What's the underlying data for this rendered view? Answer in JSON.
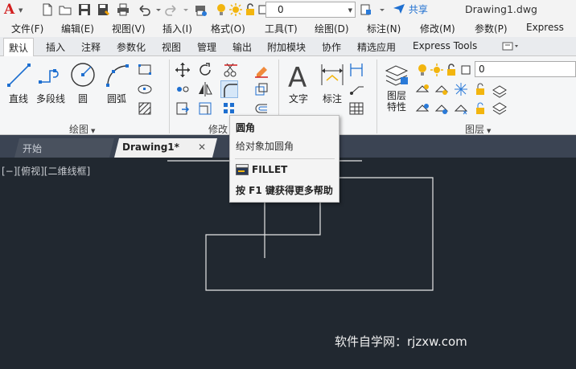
{
  "title_bar": {
    "app_logo": "A",
    "layer_value": "0",
    "share_label": "共享",
    "document_title": "Drawing1.dwg"
  },
  "menu": [
    "文件(F)",
    "编辑(E)",
    "视图(V)",
    "插入(I)",
    "格式(O)",
    "工具(T)",
    "绘图(D)",
    "标注(N)",
    "修改(M)",
    "参数(P)",
    "Express"
  ],
  "ribbon_tabs": [
    "默认",
    "插入",
    "注释",
    "参数化",
    "视图",
    "管理",
    "输出",
    "附加模块",
    "协作",
    "精选应用",
    "Express Tools"
  ],
  "ribbon": {
    "draw_panel": {
      "title": "绘图",
      "buttons": [
        "直线",
        "多段线",
        "圆",
        "圆弧"
      ]
    },
    "modify_panel": {
      "title": "修改"
    },
    "annotation_panel": {
      "buttons": [
        "文字",
        "标注"
      ]
    },
    "layers_panel": {
      "title": "图层",
      "properties_label": "图层\n特性",
      "properties_line1": "图层",
      "properties_line2": "特性",
      "layer_value": "0"
    }
  },
  "file_tabs": {
    "start": "开始",
    "drawing": "Drawing1*",
    "close_glyph": "✕"
  },
  "canvas": {
    "view_label": "[−][俯视][二维线框]",
    "watermark": "软件自学网：rjzxw.com"
  },
  "tooltip": {
    "title": "圆角",
    "description": "给对象加圆角",
    "command": "FILLET",
    "help": "按 F1 键获得更多帮助"
  },
  "colors": {
    "canvas_bg": "#212830",
    "accent_blue": "#1e6fd0",
    "logo_red": "#d21f1f",
    "lightbulb_yellow": "#f2b50f"
  }
}
